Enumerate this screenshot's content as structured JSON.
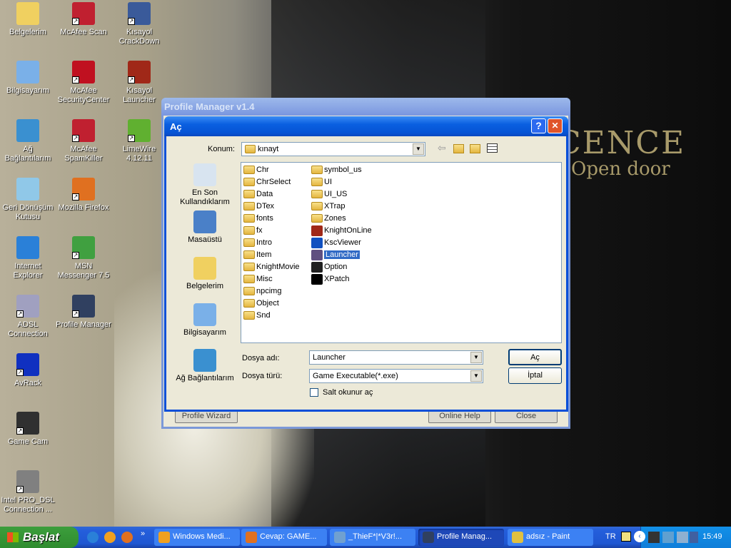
{
  "desktop": {
    "icons": [
      {
        "label": "Belgelerim",
        "icon": "my-documents-icon",
        "color": "#f0d060"
      },
      {
        "label": "McAfee Scan",
        "icon": "mcafee-scan-icon",
        "color": "#c02030"
      },
      {
        "label": "Kısayol CrackDown",
        "icon": "crackdown-icon",
        "color": "#3a5a9a"
      },
      {
        "label": "Bilgisayarım",
        "icon": "my-computer-icon",
        "color": "#7ab0e8"
      },
      {
        "label": "McAfee SecurityCenter",
        "icon": "mcafee-securitycenter-icon",
        "color": "#c01020"
      },
      {
        "label": "Kısayol Launcher",
        "icon": "launcher-icon",
        "color": "#a02818"
      },
      {
        "label": "Ağ Bağlantılarım",
        "icon": "network-icon",
        "color": "#3a90d0"
      },
      {
        "label": "McAfee SpamKiller",
        "icon": "mcafee-spamkiller-icon",
        "color": "#c02030"
      },
      {
        "label": "LimeWire 4.12.11",
        "icon": "limewire-icon",
        "color": "#60b030"
      },
      {
        "label": "Geri Dönüşüm Kutusu",
        "icon": "recycle-bin-icon",
        "color": "#90c8e8"
      },
      {
        "label": "Mozilla Firefox",
        "icon": "firefox-icon",
        "color": "#e07020"
      },
      {
        "label": "Internet Explorer",
        "icon": "internet-explorer-icon",
        "color": "#2a80d8"
      },
      {
        "label": "MSN Messenger 7.5",
        "icon": "msn-messenger-icon",
        "color": "#40a040"
      },
      {
        "label": "ADSL Connection",
        "icon": "adsl-connection-icon",
        "color": "#a0a0c0"
      },
      {
        "label": "Profile Manager",
        "icon": "profile-manager-icon",
        "color": "#304060"
      },
      {
        "label": "AvRack",
        "icon": "avrack-icon",
        "color": "#1030c0"
      },
      {
        "label": "Game Cam",
        "icon": "game-cam-icon",
        "color": "#303030"
      },
      {
        "label": "Intel PRO_DSL Connection ...",
        "icon": "intel-dsl-icon",
        "color": "#808080"
      }
    ]
  },
  "wallpaper": {
    "line1": "CENCE",
    "line2": "Open door"
  },
  "profile_manager": {
    "title": "Profile Manager v1.4",
    "buttons": {
      "wizard": "Profile Wizard",
      "help": "Online Help",
      "close": "Close"
    }
  },
  "dialog": {
    "title": "Aç",
    "help": "?",
    "close": "✕",
    "location_label": "Konum:",
    "location_value": "kınayt",
    "places": [
      "En Son Kullandıklarım",
      "Masaüstü",
      "Belgelerim",
      "Bilgisayarım",
      "Ağ Bağlantılarım"
    ],
    "files_col1": [
      "Chr",
      "ChrSelect",
      "Data",
      "DTex",
      "fonts",
      "fx",
      "Intro",
      "Item",
      "KnightMovie",
      "Misc",
      "npcimg",
      "Object",
      "Snd"
    ],
    "files_col2": [
      {
        "name": "symbol_us",
        "type": "folder"
      },
      {
        "name": "UI",
        "type": "folder"
      },
      {
        "name": "UI_US",
        "type": "folder"
      },
      {
        "name": "XTrap",
        "type": "folder"
      },
      {
        "name": "Zones",
        "type": "folder"
      },
      {
        "name": "KnightOnLine",
        "type": "exe",
        "color": "#a02818"
      },
      {
        "name": "KscViewer",
        "type": "exe",
        "color": "#1050c0"
      },
      {
        "name": "Launcher",
        "type": "exe",
        "color": "#605080",
        "selected": true
      },
      {
        "name": "Option",
        "type": "exe",
        "color": "#202020"
      },
      {
        "name": "XPatch",
        "type": "exe",
        "color": "#000000"
      }
    ],
    "filename_label": "Dosya adı:",
    "filename_value": "Launcher",
    "filetype_label": "Dosya türü:",
    "filetype_value": "Game Executable(*.exe)",
    "readonly_label": "Salt okunur aç",
    "readonly_checked": false,
    "open_button": "Aç",
    "cancel_button": "İptal"
  },
  "taskbar": {
    "start": "Başlat",
    "tasks": [
      "Windows Medi...",
      "Cevap: GAME...",
      "_ThieF*|*V3r!...",
      "Profile Manag...",
      "adsız - Paint"
    ],
    "active_task": 3,
    "language": "TR",
    "clock": "15:49"
  }
}
